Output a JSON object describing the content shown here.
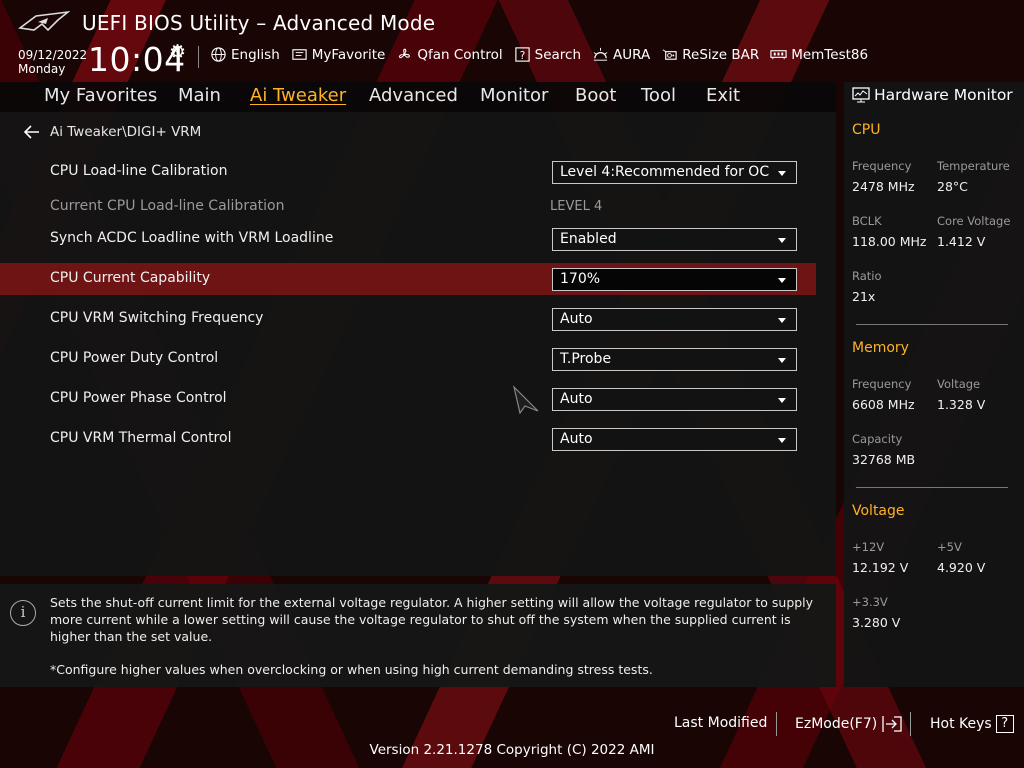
{
  "header": {
    "title": "UEFI BIOS Utility – Advanced Mode",
    "date": "09/12/2022",
    "day": "Monday",
    "time": "10:04",
    "toolbar": [
      {
        "label": "English",
        "icon": "globe-icon"
      },
      {
        "label": "MyFavorite",
        "icon": "favorite-icon"
      },
      {
        "label": "Qfan Control",
        "icon": "fan-icon"
      },
      {
        "label": "Search",
        "icon": "search-help-icon"
      },
      {
        "label": "AURA",
        "icon": "aura-icon"
      },
      {
        "label": "ReSize BAR",
        "icon": "resize-bar-icon"
      },
      {
        "label": "MemTest86",
        "icon": "memtest-icon"
      }
    ]
  },
  "menu": {
    "items": [
      "My Favorites",
      "Main",
      "Ai Tweaker",
      "Advanced",
      "Monitor",
      "Boot",
      "Tool",
      "Exit"
    ],
    "active": "Ai Tweaker"
  },
  "breadcrumb": "Ai Tweaker\\DIGI+ VRM",
  "settings": [
    {
      "label": "CPU Load-line Calibration",
      "value": "Level 4:Recommended for OC",
      "type": "dropdown"
    },
    {
      "label": "Current CPU Load-line Calibration",
      "value": "LEVEL 4",
      "type": "readonly"
    },
    {
      "label": "Synch ACDC Loadline with VRM Loadline",
      "value": "Enabled",
      "type": "dropdown"
    },
    {
      "label": "CPU Current Capability",
      "value": "170%",
      "type": "dropdown",
      "selected": true
    },
    {
      "label": "CPU VRM Switching Frequency",
      "value": "Auto",
      "type": "dropdown"
    },
    {
      "label": "CPU Power Duty Control",
      "value": "T.Probe",
      "type": "dropdown"
    },
    {
      "label": "CPU Power Phase Control",
      "value": "Auto",
      "type": "dropdown"
    },
    {
      "label": "CPU VRM Thermal Control",
      "value": "Auto",
      "type": "dropdown"
    }
  ],
  "help": {
    "text": "Sets the shut-off current limit for the external voltage regulator. A higher setting will allow the voltage regulator to supply more current while a lower setting will cause the voltage regulator to shut off the system when the supplied current is higher than the set value.",
    "note": "*Configure higher values when overclocking or when using high current demanding stress tests."
  },
  "hw_monitor": {
    "title": "Hardware Monitor",
    "cpu": {
      "heading": "CPU",
      "frequency_label": "Frequency",
      "frequency": "2478 MHz",
      "temperature_label": "Temperature",
      "temperature": "28°C",
      "bclk_label": "BCLK",
      "bclk": "118.00 MHz",
      "core_voltage_label": "Core Voltage",
      "core_voltage": "1.412 V",
      "ratio_label": "Ratio",
      "ratio": "21x"
    },
    "memory": {
      "heading": "Memory",
      "frequency_label": "Frequency",
      "frequency": "6608 MHz",
      "voltage_label": "Voltage",
      "voltage": "1.328 V",
      "capacity_label": "Capacity",
      "capacity": "32768 MB"
    },
    "voltage": {
      "heading": "Voltage",
      "v12_label": "+12V",
      "v12": "12.192 V",
      "v5_label": "+5V",
      "v5": "4.920 V",
      "v33_label": "+3.3V",
      "v33": "3.280 V"
    }
  },
  "footer": {
    "last_modified": "Last Modified",
    "ezmode": "EzMode(F7)",
    "hotkeys": "Hot Keys",
    "hotkeys_key": "?",
    "version": "Version 2.21.1278 Copyright (C) 2022 AMI"
  },
  "colors": {
    "accent": "#ffb128",
    "highlight_row": "#6e1414",
    "background": "#1a0505"
  }
}
